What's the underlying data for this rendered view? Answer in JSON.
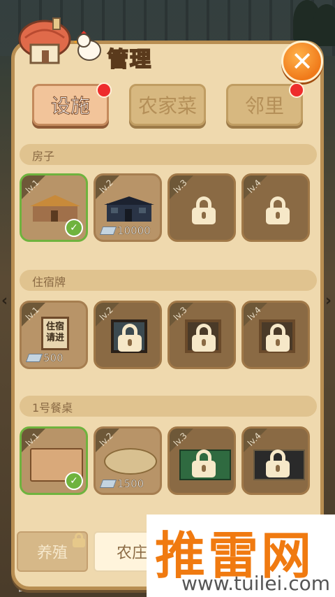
{
  "header": {
    "title": "管理",
    "close_icon": "close-icon"
  },
  "tabs": [
    {
      "label": "设施",
      "active": true,
      "badge": true
    },
    {
      "label": "农家菜",
      "active": false,
      "badge": false
    },
    {
      "label": "邻里",
      "active": false,
      "badge": true
    }
  ],
  "sections": [
    {
      "title": "房子",
      "items": [
        {
          "level": "lv.1",
          "state": "current",
          "price": ""
        },
        {
          "level": "lv.2",
          "state": "unlocked",
          "price": "10000"
        },
        {
          "level": "lv.3",
          "state": "locked",
          "price": ""
        },
        {
          "level": "lv.4",
          "state": "locked",
          "price": ""
        }
      ]
    },
    {
      "title": "住宿牌",
      "items": [
        {
          "level": "lv.1",
          "state": "unlocked",
          "price": "500",
          "sign_text": "住宿请进"
        },
        {
          "level": "lv.2",
          "state": "locked",
          "price": ""
        },
        {
          "level": "lv.3",
          "state": "locked",
          "price": ""
        },
        {
          "level": "lv.4",
          "state": "locked",
          "price": ""
        }
      ]
    },
    {
      "title": "1号餐桌",
      "items": [
        {
          "level": "lv.1",
          "state": "current",
          "price": ""
        },
        {
          "level": "lv.2",
          "state": "unlocked",
          "price": "1500"
        },
        {
          "level": "lv.3",
          "state": "locked",
          "price": ""
        },
        {
          "level": "lv.4",
          "state": "locked",
          "price": ""
        }
      ]
    }
  ],
  "bottom_tabs": [
    {
      "label": "养殖",
      "locked": true
    },
    {
      "label": "农庄",
      "locked": false
    }
  ],
  "background_text": "管理",
  "watermark": {
    "big": "推雷网",
    "small": "www.tuilei.com"
  },
  "colors": {
    "accent": "#f07a1a",
    "current_border": "#6fb33e",
    "badge": "#ee2c2c",
    "panel": "#efd9ae"
  }
}
